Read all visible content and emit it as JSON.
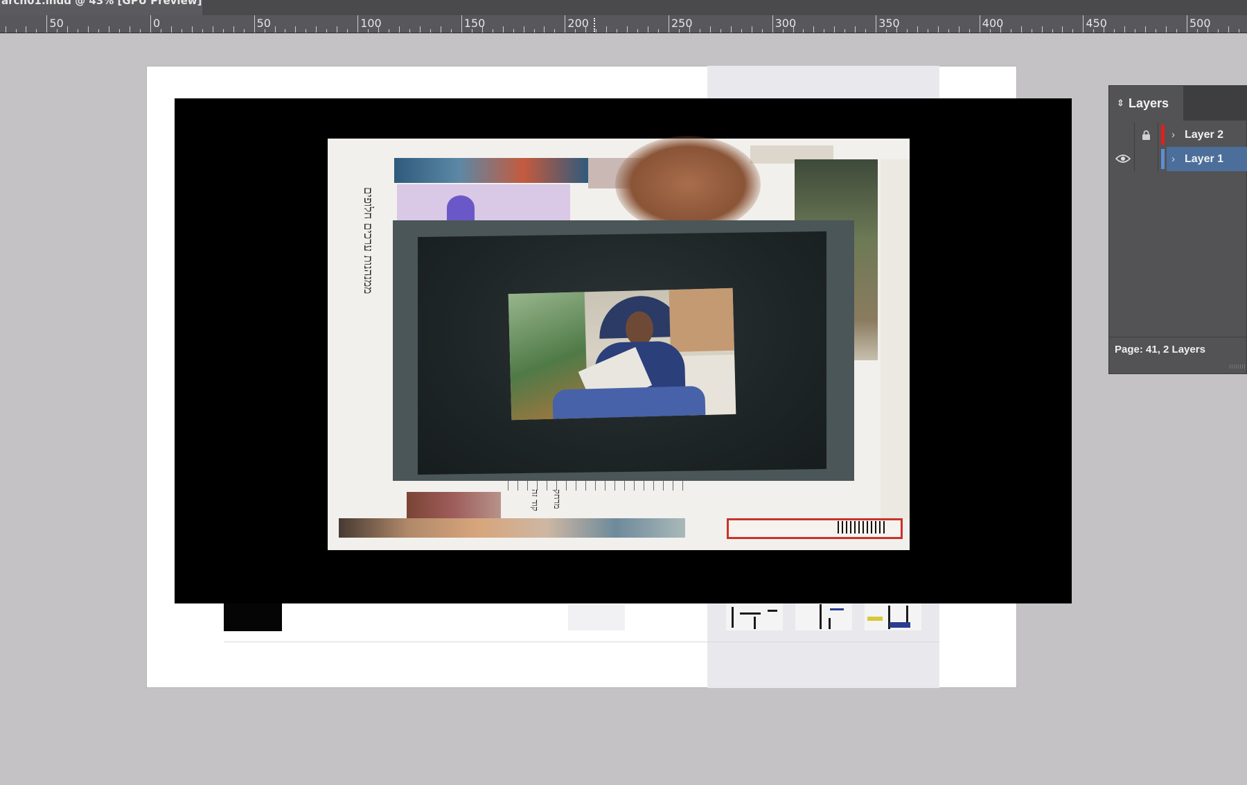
{
  "window": {
    "document_tab": "arch01.indd @ 43% [GPU Preview]"
  },
  "ruler": {
    "labels": [
      "50",
      "0",
      "50",
      "100",
      "150",
      "200",
      "250",
      "300",
      "350",
      "400",
      "450",
      "500"
    ]
  },
  "canvas": {
    "page_background": "#ffffff",
    "pasteboard": "#c4c2c5"
  },
  "layers_panel": {
    "tab_label": "Layers",
    "layers": [
      {
        "name": "Layer 2",
        "color": "#e0201d",
        "locked": true,
        "visible": false,
        "selected": false
      },
      {
        "name": "Layer 1",
        "color": "#5b8fd6",
        "locked": false,
        "visible": true,
        "selected": true
      }
    ],
    "footer": "Page: 41, 2 Layers"
  },
  "icons": {
    "lock": "lock-icon",
    "eye": "eye-icon",
    "expand": "chevron-right-icon",
    "tab_arrows": "sort-arrows-icon"
  }
}
